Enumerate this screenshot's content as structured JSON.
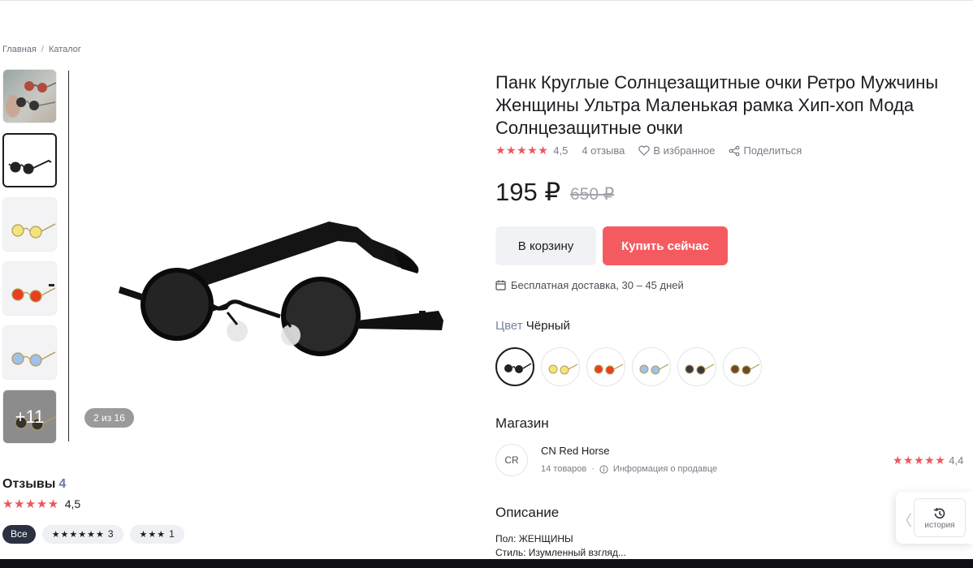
{
  "breadcrumb": {
    "home": "Главная",
    "sep": "/",
    "catalog": "Каталог"
  },
  "gallery": {
    "more_label": "+11",
    "counter": "2 из 16",
    "thumbnails": [
      "photo",
      "black",
      "yellow",
      "red",
      "blue",
      "more"
    ]
  },
  "reviews": {
    "title": "Отзывы",
    "count": "4",
    "stars": "★★★★★",
    "rating": "4,5",
    "filters": {
      "all": "Все",
      "five_stars": "★★★★★★",
      "five_count": "3",
      "three_stars": "★★★",
      "three_count": "1"
    }
  },
  "product": {
    "title": "Панк Круглые Солнцезащитные очки Ретро Мужчины Женщины Ультра Маленькая рамка Хип-хоп Мода Солнцезащитные очки",
    "stars": "★★★★★",
    "rating": "4,5",
    "reviews_count": "4 отзыва",
    "favorite": "В избранное",
    "share": "Поделиться",
    "price": "195 ₽",
    "old_price": "650 ₽",
    "cart_label": "В корзину",
    "buy_label": "Купить сейчас",
    "delivery": "Бесплатная доставка, 30 – 45 дней",
    "color_key": "Цвет",
    "color_value": "Чёрный",
    "swatches": [
      "black",
      "yellow",
      "red",
      "blue",
      "dark-grey",
      "brown"
    ]
  },
  "shop": {
    "section_title": "Магазин",
    "avatar": "CR",
    "name": "CN Red Horse",
    "goods": "14 товаров",
    "dot": "·",
    "info": "Информация о продавце",
    "stars": "★★★★★",
    "rating": "4,4"
  },
  "description": {
    "title": "Описание",
    "lines": [
      "Пол: ЖЕНЩИНЫ",
      "Стиль: Изумленный взгляд..."
    ]
  },
  "history": {
    "label": "история"
  },
  "colors": {
    "accent": "#f45b61",
    "star": "#f0545c",
    "dark": "#1c1d22"
  }
}
